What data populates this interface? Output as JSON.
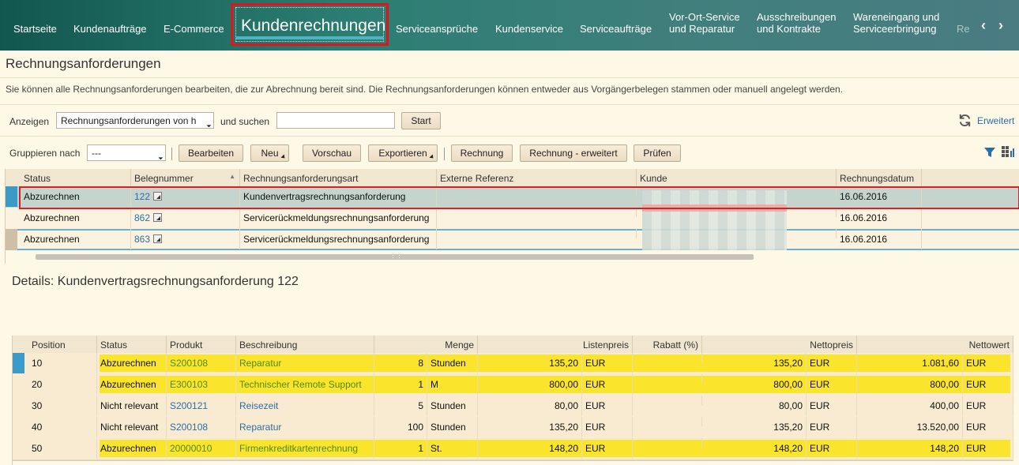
{
  "nav": {
    "items": [
      {
        "label": "Startseite"
      },
      {
        "label": "Kundenaufträge"
      },
      {
        "label": "E-Commerce"
      },
      {
        "label": "Serviceansprüche"
      },
      {
        "label": "Kundenservice"
      },
      {
        "label": "Serviceaufträge"
      }
    ],
    "two_line": [
      {
        "l1": "Vor-Ort-Service",
        "l2": "und Reparatur"
      },
      {
        "l1": "Ausschreibungen",
        "l2": "und Kontrakte"
      },
      {
        "l1": "Wareneingang und",
        "l2": "Serviceerbringung"
      }
    ],
    "active": "Kundenrechnungen",
    "more": "Re",
    "prev_icon": "chevron-left-icon",
    "next_icon": "chevron-right-icon"
  },
  "page": {
    "title": "Rechnungsanforderungen",
    "description": "Sie können alle Rechnungsanforderungen bearbeiten, die zur Abrechnung bereit sind. Die Rechnungsanforderungen können entweder aus Vorgängerbelegen stammen oder manuell angelegt werden."
  },
  "search": {
    "show_label": "Anzeigen",
    "show_value": "Rechnungsanforderungen von h",
    "and_search_label": "und suchen",
    "search_value": "",
    "start_label": "Start",
    "advanced_label": "Erweitert"
  },
  "toolbar": {
    "group_label": "Gruppieren nach",
    "group_value": "---",
    "edit": "Bearbeiten",
    "new": "Neu",
    "preview": "Vorschau",
    "export": "Exportieren",
    "invoice": "Rechnung",
    "invoice_ext": "Rechnung - erweitert",
    "check": "Prüfen"
  },
  "requests": {
    "columns": [
      "Status",
      "Belegnummer",
      "Rechnungsanforderungsart",
      "Externe Referenz",
      "Kunde",
      "Rechnungsdatum"
    ],
    "rows": [
      {
        "status": "Abzurechnen",
        "number": "122",
        "type": "Kundenvertragsrechnungsanforderung",
        "ref": "",
        "date": "16.06.2016"
      },
      {
        "status": "Abzurechnen",
        "number": "862",
        "type": "Servicerückmeldungsrechnungsanforderung",
        "ref": "",
        "date": "16.06.2016"
      },
      {
        "status": "Abzurechnen",
        "number": "863",
        "type": "Servicerückmeldungsrechnungsanforderung",
        "ref": "",
        "date": "16.06.2016"
      }
    ]
  },
  "details": {
    "title": "Details: Kundenvertragsrechnungsanforderung 122",
    "columns": [
      "Position",
      "Status",
      "Produkt",
      "Beschreibung",
      "Menge",
      "Listenpreis",
      "Rabatt (%)",
      "Nettopreis",
      "Nettowert"
    ],
    "rows": [
      {
        "pos": "10",
        "status": "Abzurechnen",
        "product": "S200108",
        "desc": "Reparatur",
        "qty": "8",
        "unit": "Stunden",
        "list": "135,20",
        "list_cur": "EUR",
        "discount": "",
        "net": "135,20",
        "net_cur": "EUR",
        "value": "1.081,60",
        "value_cur": "EUR"
      },
      {
        "pos": "20",
        "status": "Abzurechnen",
        "product": "E300103",
        "desc": "Technischer Remote Support",
        "qty": "1",
        "unit": "M",
        "list": "800,00",
        "list_cur": "EUR",
        "discount": "",
        "net": "800,00",
        "net_cur": "EUR",
        "value": "800,00",
        "value_cur": "EUR"
      },
      {
        "pos": "30",
        "status": "Nicht relevant",
        "product": "S200121",
        "desc": "Reisezeit",
        "qty": "5",
        "unit": "Stunden",
        "list": "80,00",
        "list_cur": "EUR",
        "discount": "",
        "net": "80,00",
        "net_cur": "EUR",
        "value": "400,00",
        "value_cur": "EUR"
      },
      {
        "pos": "40",
        "status": "Nicht relevant",
        "product": "S200108",
        "desc": "Reparatur",
        "qty": "100",
        "unit": "Stunden",
        "list": "135,20",
        "list_cur": "EUR",
        "discount": "",
        "net": "135,20",
        "net_cur": "EUR",
        "value": "13.520,00",
        "value_cur": "EUR"
      },
      {
        "pos": "50",
        "status": "Abzurechnen",
        "product": "20000010",
        "desc": "Firmenkreditkartenrechnung",
        "qty": "1",
        "unit": "St.",
        "list": "148,20",
        "list_cur": "EUR",
        "discount": "",
        "net": "148,20",
        "net_cur": "EUR",
        "value": "148,20",
        "value_cur": "EUR"
      }
    ]
  },
  "colors": {
    "highlight": "#fbe52c",
    "accent": "#e0141b",
    "link": "#2a6ea8",
    "nav": "#2c7e73"
  }
}
